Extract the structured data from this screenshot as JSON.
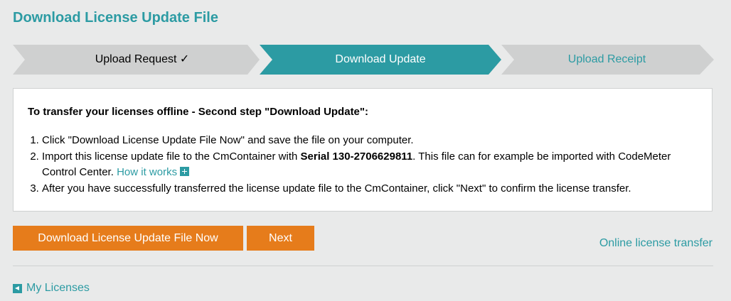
{
  "page": {
    "title": "Download License Update File"
  },
  "steps": [
    {
      "label": "Upload Request ✓",
      "state": "completed",
      "color": "#cfd0d0",
      "text_color": "#000000"
    },
    {
      "label": "Download Update",
      "state": "active",
      "color": "#2c9ba3",
      "text_color": "#ffffff"
    },
    {
      "label": "Upload Receipt",
      "state": "pending",
      "color": "#cfd0d0",
      "text_color": "#2c9ba3"
    }
  ],
  "instructions": {
    "heading": "To transfer your licenses offline - Second step \"Download Update\":",
    "item1": "Click \"Download License Update File Now\" and save the file on your computer.",
    "item2_before": "Import this license update file to the CmContainer with ",
    "item2_serial": "Serial 130-2706629811",
    "item2_after": ". This file can for example be imported with CodeMeter Control Center.",
    "item2_link": "How it works",
    "item3": "After you have successfully transferred the license update file to the CmContainer, click \"Next\" to confirm the license transfer."
  },
  "actions": {
    "download_label": "Download License Update File Now",
    "next_label": "Next",
    "online_transfer_label": "Online license transfer"
  },
  "footer": {
    "my_licenses_label": "My Licenses"
  },
  "colors": {
    "accent": "#2c9ba3",
    "button": "#e67c1b",
    "background": "#e9eaea"
  },
  "icons": [
    "check-icon",
    "plus-icon",
    "back-arrow-icon"
  ]
}
